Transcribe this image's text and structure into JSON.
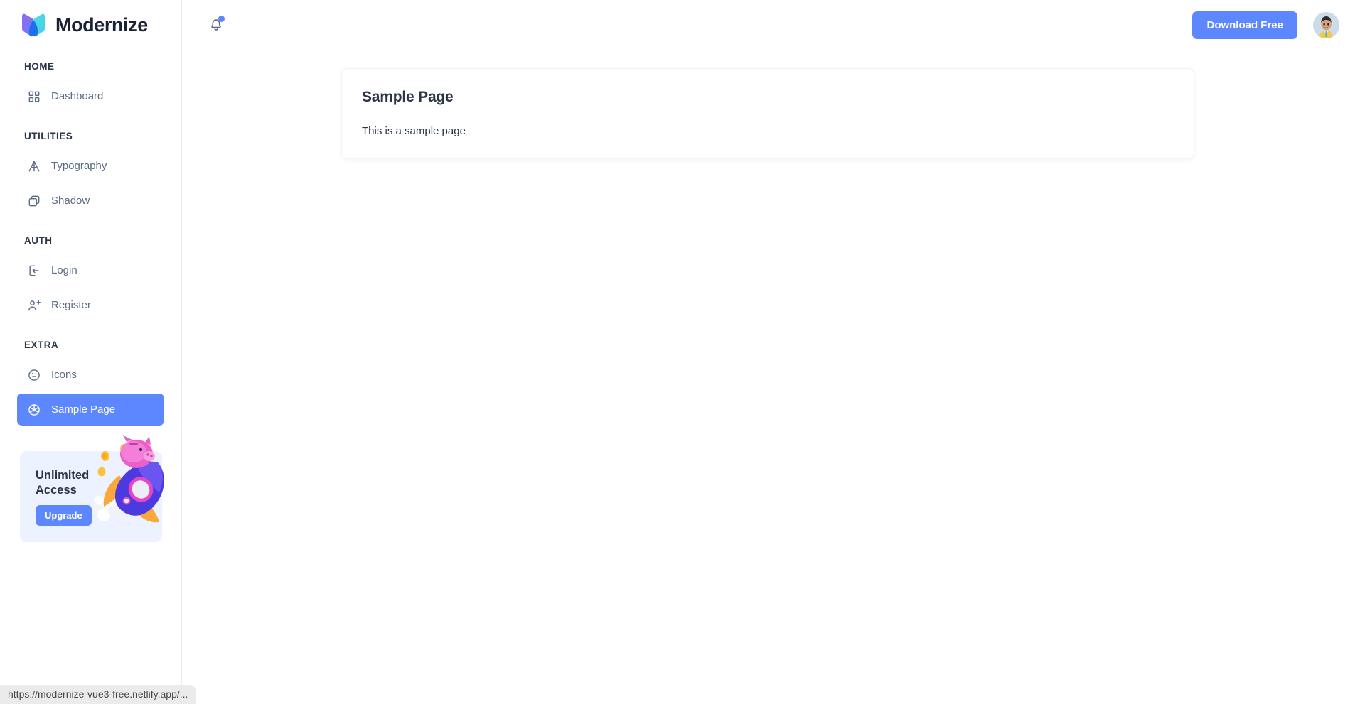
{
  "brand": {
    "name": "Modernize",
    "logo_icon": "butterfly-logo-icon"
  },
  "sidebar": {
    "sections": [
      {
        "label": "HOME",
        "items": [
          {
            "label": "Dashboard",
            "icon": "layout-grid-icon",
            "active": false
          }
        ]
      },
      {
        "label": "UTILITIES",
        "items": [
          {
            "label": "Typography",
            "icon": "typography-icon",
            "active": false
          },
          {
            "label": "Shadow",
            "icon": "copy-shadow-icon",
            "active": false
          }
        ]
      },
      {
        "label": "AUTH",
        "items": [
          {
            "label": "Login",
            "icon": "login-icon",
            "active": false
          },
          {
            "label": "Register",
            "icon": "user-plus-icon",
            "active": false
          }
        ]
      },
      {
        "label": "EXTRA",
        "items": [
          {
            "label": "Icons",
            "icon": "smiley-face-icon",
            "active": false
          },
          {
            "label": "Sample Page",
            "icon": "aperture-icon",
            "active": true
          }
        ]
      }
    ],
    "promo": {
      "title_line1": "Unlimited",
      "title_line2": "Access",
      "button_label": "Upgrade",
      "art_icon": "rocket-piggybank-illustration"
    }
  },
  "topbar": {
    "notification_icon": "bell-icon",
    "notification_has_badge": true,
    "download_label": "Download Free",
    "avatar_icon": "user-avatar"
  },
  "main": {
    "card": {
      "title": "Sample Page",
      "body": "This is a sample page"
    }
  },
  "statusbar": {
    "url": "https://modernize-vue3-free.netlify.app/..."
  },
  "colors": {
    "accent": "#5d87ff",
    "promo_bg": "#ecf2ff",
    "text_primary": "#2a3547",
    "text_muted": "#5a6a85",
    "border": "#e9edf2"
  }
}
